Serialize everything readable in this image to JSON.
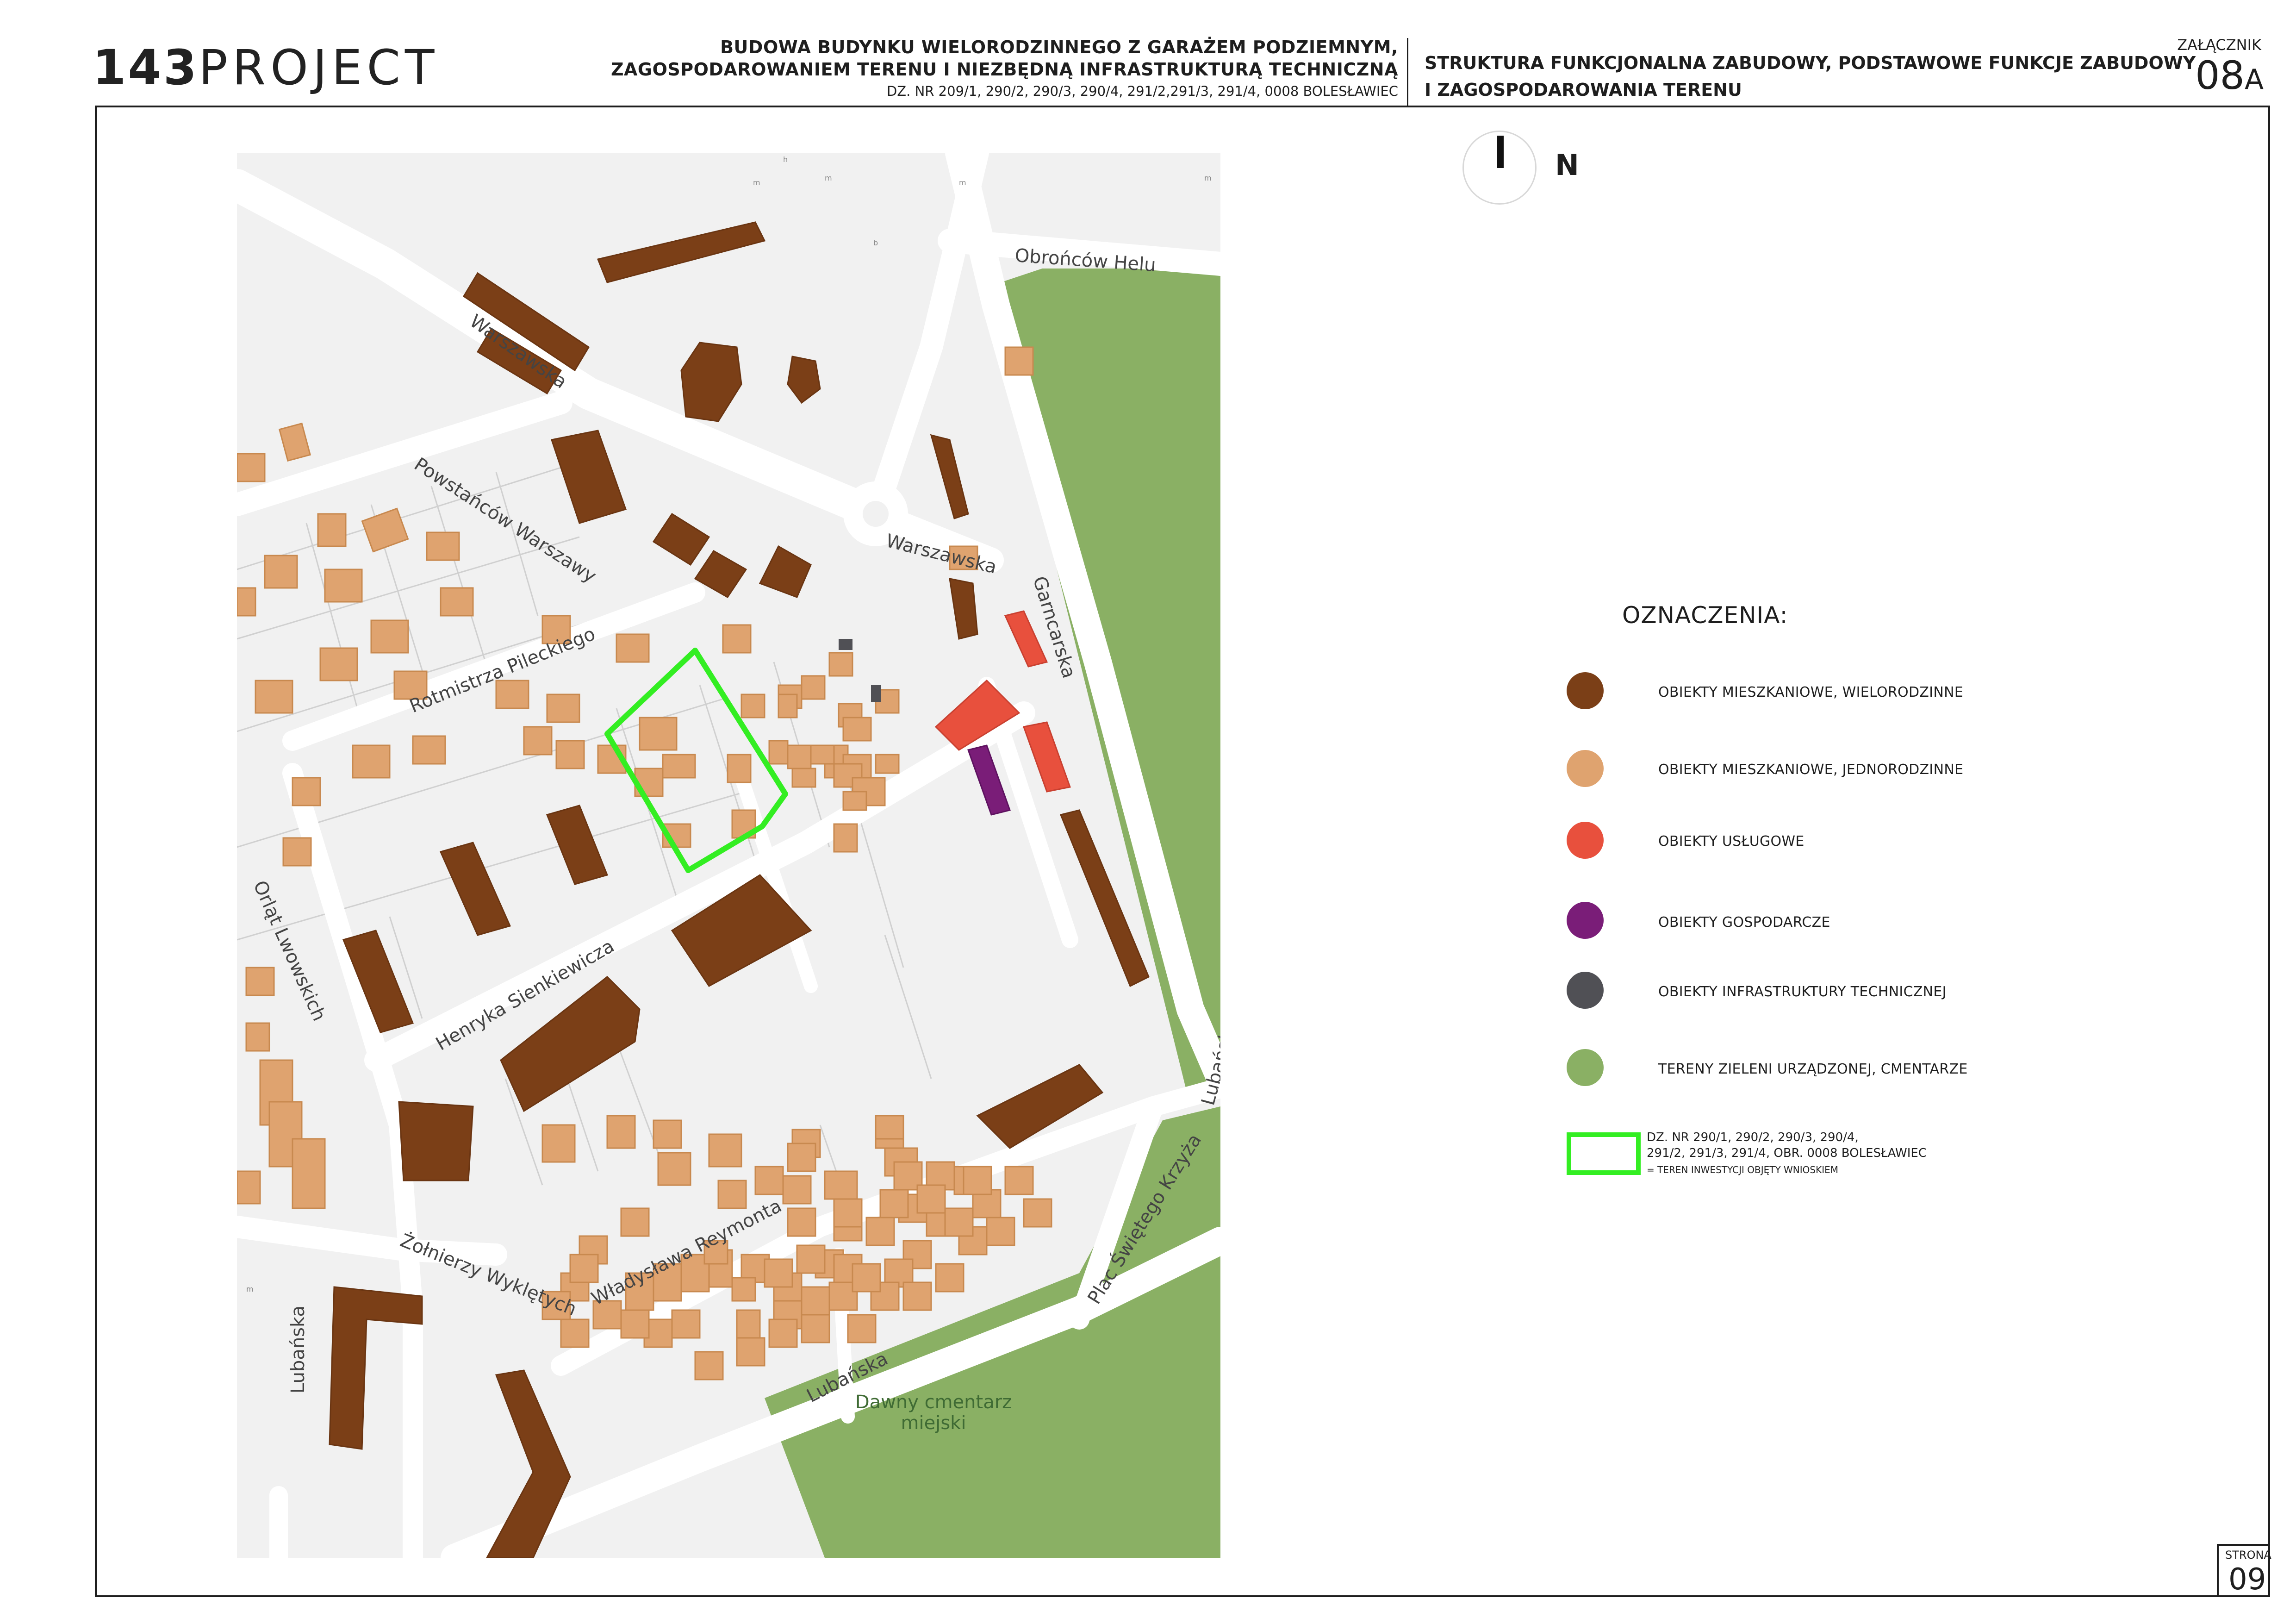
{
  "header": {
    "logo_number": "143",
    "logo_word": "PROJECT",
    "project_title_line1": "BUDOWA BUDYNKU WIELORODZINNEGO Z GARAŻEM PODZIEMNYM,",
    "project_title_line2": "ZAGOSPODAROWANIEM TERENU I NIEZBĘDNĄ INFRASTRUKTURĄ TECHNICZNĄ",
    "project_plots": "DZ. NR 209/1, 290/2, 290/3, 290/4, 291/2,291/3, 291/4, 0008 BOLESŁAWIEC",
    "sheet_title_line1": "STRUKTURA FUNKCJONALNA ZABUDOWY, PODSTAWOWE FUNKCJE ZABUDOWY",
    "sheet_title_line2": "I ZAGOSPODAROWANIA TERENU",
    "attachment_label": "ZAŁĄCZNIK",
    "attachment_number": "08",
    "attachment_suffix": "A"
  },
  "compass": {
    "label": "N"
  },
  "map": {
    "streets": [
      "Obrońców Helu",
      "Warszawska",
      "Powstańców Warszawy",
      "Warszawska",
      "Garncarska",
      "Rotmistrza Pileckiego",
      "Orląt Lwowskich",
      "Henryka Sienkiewicza",
      "Lubańska",
      "Władysława Reymonta",
      "Żołnierzy Wyklętych",
      "Plac Świętego Krzyża",
      "Lubańska",
      "Lubańska"
    ],
    "place_label_line1": "Dawny cmentarz",
    "place_label_line2": "miejski",
    "building_tags": [
      "h",
      "m",
      "m",
      "b",
      "m",
      "m",
      "m"
    ],
    "colors": {
      "multi_family": "#7b3f17",
      "single_family": "#dfa36f",
      "services": "#e8503d",
      "utility": "#7a1d78",
      "infrastructure": "#505055",
      "green": "#8ab064",
      "investment_outline": "#33ee22"
    }
  },
  "legend": {
    "title": "OZNACZENIA:",
    "items": [
      {
        "label": "OBIEKTY MIESZKANIOWE, WIELORODZINNE",
        "color": "#7b3f17"
      },
      {
        "label": "OBIEKTY MIESZKANIOWE, JEDNORODZINNE",
        "color": "#dfa36f"
      },
      {
        "label": "OBIEKTY USŁUGOWE",
        "color": "#e8503d"
      },
      {
        "label": "OBIEKTY GOSPODARCZE",
        "color": "#7a1d78"
      },
      {
        "label": "OBIEKTY INFRASTRUKTURY TECHNICZNEJ",
        "color": "#505055"
      },
      {
        "label": "TERENY ZIELENI URZĄDZONEJ, CMENTARZE",
        "color": "#8ab064"
      }
    ],
    "investment_line1": "DZ. NR 290/1, 290/2, 290/3, 290/4,",
    "investment_line2": "291/2, 291/3, 291/4, OBR. 0008 BOLESŁAWIEC",
    "investment_line3": "= TEREN INWESTYCJI OBJĘTY WNIOSKIEM"
  },
  "page": {
    "label": "STRONA",
    "number": "09"
  }
}
